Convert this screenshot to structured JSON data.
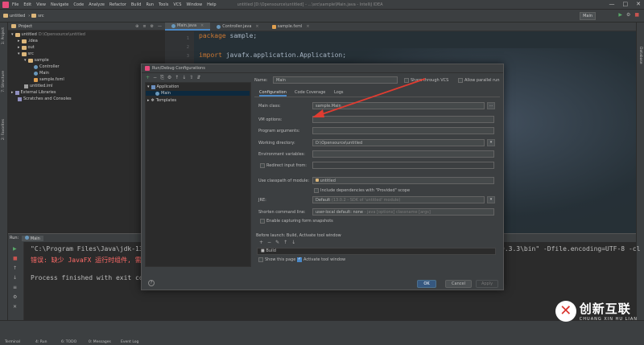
{
  "menubar": {
    "items": [
      "File",
      "Edit",
      "View",
      "Navigate",
      "Code",
      "Analyze",
      "Refactor",
      "Build",
      "Run",
      "Tools",
      "VCS",
      "Window",
      "Help"
    ],
    "title": "untitled [D:\\Opensource\\untitled] - ...\\src\\sample\\Main.java - IntelliJ IDEA",
    "controls": [
      "—",
      "□",
      "✕"
    ]
  },
  "navbar": {
    "project": "untitled",
    "src": "src",
    "run_config": "Main",
    "icons": [
      "▶",
      "⚙",
      "■"
    ]
  },
  "left_strip": {
    "project_tab": "1: Project",
    "structure_tab": "7: Structure",
    "favorites_tab": "2: Favorites"
  },
  "right_strip": {
    "database_tab": "Database"
  },
  "project_panel": {
    "title": "Project",
    "tools": [
      "⊕",
      "≡",
      "⚙",
      "—"
    ],
    "tree": [
      {
        "label": "untitled",
        "hint": "D:\\Opensource\\untitled",
        "icon": "folder"
      },
      {
        "label": ".idea",
        "icon": "folder"
      },
      {
        "label": "out",
        "icon": "folder"
      },
      {
        "label": "src",
        "icon": "folder"
      },
      {
        "label": "sample",
        "icon": "folder"
      },
      {
        "label": "Controller",
        "icon": "file"
      },
      {
        "label": "Main",
        "icon": "file"
      },
      {
        "label": "sample.fxml",
        "icon": "fx"
      },
      {
        "label": "untitled.iml",
        "icon": "iml"
      },
      {
        "label": "External Libraries",
        "icon": "lib"
      },
      {
        "label": "Scratches and Consoles",
        "icon": "lib"
      }
    ]
  },
  "editor": {
    "tabs": [
      "Main.java",
      "Controller.java",
      "sample.fxml"
    ],
    "lines": [
      {
        "num": "1",
        "kw": "package",
        "id": " sample;"
      },
      {
        "num": "2",
        "kw": "",
        "id": ""
      },
      {
        "num": "3",
        "kw": "import",
        "id": " javafx.application.Application;"
      }
    ]
  },
  "run_panel": {
    "header_run": "Run:",
    "header_tab": "Main",
    "line1": "\"C:\\Program Files\\Java\\jdk-13.",
    "line1_right": "9.3.3\\bin\" -Dfile.encoding=UTF-8 -cl",
    "line2": "错误: 缺少 JavaFX 运行时组件, 需",
    "line3": "Process finished with exit cod",
    "tools": [
      "▶",
      "■",
      "↑",
      "↓",
      "≡",
      "⚙",
      "✕"
    ]
  },
  "bottom_bar": {
    "tabs": [
      "Terminal",
      "4: Run",
      "6: TODO",
      "0: Messages",
      "Event Log"
    ]
  },
  "dialog": {
    "title": "Run/Debug Configurations",
    "toolbar": [
      "+",
      "−",
      "⎘",
      "⚙",
      "↑",
      "↓",
      "⇧",
      "⇵"
    ],
    "tree": {
      "application": "Application",
      "main": "Main",
      "templates": "Templates"
    },
    "name_label": "Name:",
    "name_value": "Main",
    "share_label": "Share through VCS",
    "parallel_label": "Allow parallel run",
    "tabs": [
      "Configuration",
      "Code Coverage",
      "Logs"
    ],
    "main_class_label": "Main class:",
    "main_class_value": "sample.Main",
    "vm_options_label": "VM options:",
    "program_args_label": "Program arguments:",
    "working_dir_label": "Working directory:",
    "working_dir_value": "D:\\Opensource\\untitled",
    "env_label": "Environment variables:",
    "redirect_label": "Redirect input from:",
    "classpath_label": "Use classpath of module:",
    "classpath_value": "untitled",
    "include_deps_label": "Include dependencies with \"Provided\" scope",
    "jre_label": "JRE:",
    "jre_value": "Default",
    "jre_hint": "(13.0.2 - SDK of 'untitled' module)",
    "shorten_label": "Shorten command line:",
    "shorten_value": "user-local default: none",
    "shorten_hint": "- java [options] classname [args]",
    "snapshots_label": "Enable capturing form snapshots",
    "before_launch_label": "Before launch: Build, Activate tool window",
    "before_tools": [
      "+",
      "−",
      "✎",
      "↑",
      "↓"
    ],
    "build_item": "Build",
    "show_page_label": "Show this page",
    "activate_label": "Activate tool window",
    "ok": "OK",
    "cancel": "Cancel",
    "apply": "Apply",
    "help": "?"
  },
  "watermark": {
    "logo_glyph": "✕",
    "main": "创新互联",
    "sub": "CHUANG XIN HU LIAN"
  },
  "colors": {
    "accent": "#4a88c7",
    "annotation_arrow": "#e03c31",
    "keyword": "#cc7832",
    "error": "#ff6b68"
  }
}
